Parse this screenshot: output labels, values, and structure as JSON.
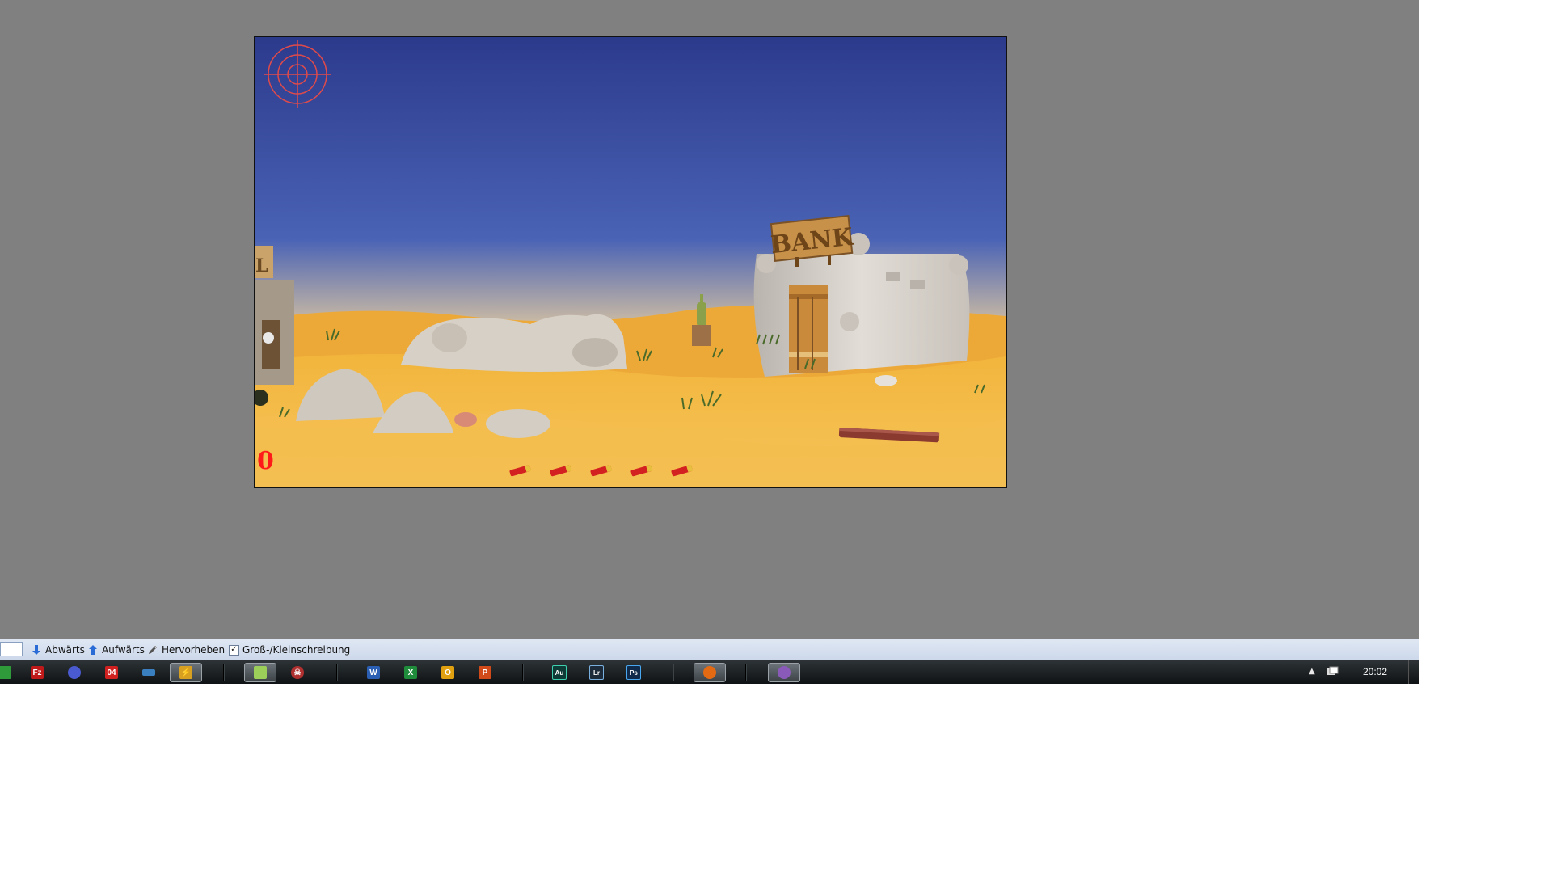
{
  "game": {
    "score": "0",
    "bank_sign": "BANK",
    "shells": 5,
    "colors": {
      "sky_top": "#2c3a8c",
      "sky_bottom": "#f2c27a",
      "sand": "#f0b43e",
      "accent": "#ff1a1a"
    }
  },
  "findbar": {
    "down_label": "Abwärts",
    "up_label": "Aufwärts",
    "highlight_label": "Hervorheben",
    "matchcase_label": "Groß-/Kleinschreibung",
    "matchcase_checked": "✓"
  },
  "taskbar": {
    "apps": [
      {
        "icon": "filezilla-icon",
        "label": "Fz",
        "color": "#c0191a"
      },
      {
        "icon": "globe-app-icon",
        "label": "",
        "color": "#4a5ad0"
      },
      {
        "icon": "calendar-app-icon",
        "label": "04",
        "color": "#d02020"
      },
      {
        "icon": "network-app-icon",
        "label": "",
        "color": "#3a7fbf"
      },
      {
        "icon": "winamp-icon",
        "label": "⚡",
        "color": "#d8a020"
      },
      {
        "icon": "notepad-icon",
        "label": "",
        "color": "#9bcf5a"
      },
      {
        "icon": "skull-app-icon",
        "label": "☠",
        "color": "#b03030"
      },
      {
        "icon": "word-icon",
        "label": "W",
        "color": "#2b5fb3"
      },
      {
        "icon": "excel-icon",
        "label": "X",
        "color": "#1e8c3a"
      },
      {
        "icon": "outlook-icon",
        "label": "O",
        "color": "#e0a010"
      },
      {
        "icon": "powerpoint-icon",
        "label": "P",
        "color": "#d04a1a"
      },
      {
        "icon": "audition-icon",
        "label": "Au",
        "color": "#0e3b36"
      },
      {
        "icon": "lightroom-icon",
        "label": "Lr",
        "color": "#1c2a3a"
      },
      {
        "icon": "photoshop-icon",
        "label": "Ps",
        "color": "#0f2a4a"
      },
      {
        "icon": "firefox-icon",
        "label": "",
        "color": "#e36a12"
      },
      {
        "icon": "game-app-icon",
        "label": "",
        "color": "#8a5ab8"
      }
    ],
    "clock": "20:02"
  }
}
